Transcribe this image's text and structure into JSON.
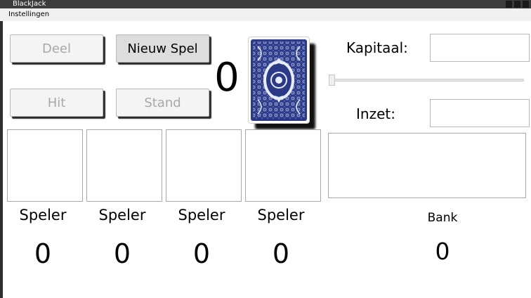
{
  "window": {
    "title": "BlackJack"
  },
  "menu": {
    "items": [
      {
        "label": "Instellingen"
      }
    ]
  },
  "buttons": {
    "deel": "Deel",
    "nieuw_spel": "Nieuw Spel",
    "hit": "Hit",
    "stand": "Stand"
  },
  "deck": {
    "count": "0",
    "card_back_color": "#2b3a86"
  },
  "kapitaal": {
    "label": "Kapitaal:",
    "value": ""
  },
  "inzet": {
    "label": "Inzet:",
    "value": "",
    "slider_value": 0
  },
  "players": [
    {
      "label": "Speler",
      "score": "0"
    },
    {
      "label": "Speler",
      "score": "0"
    },
    {
      "label": "Speler",
      "score": "0"
    },
    {
      "label": "Speler",
      "score": "0"
    }
  ],
  "bank": {
    "label": "Bank",
    "score": "0"
  }
}
